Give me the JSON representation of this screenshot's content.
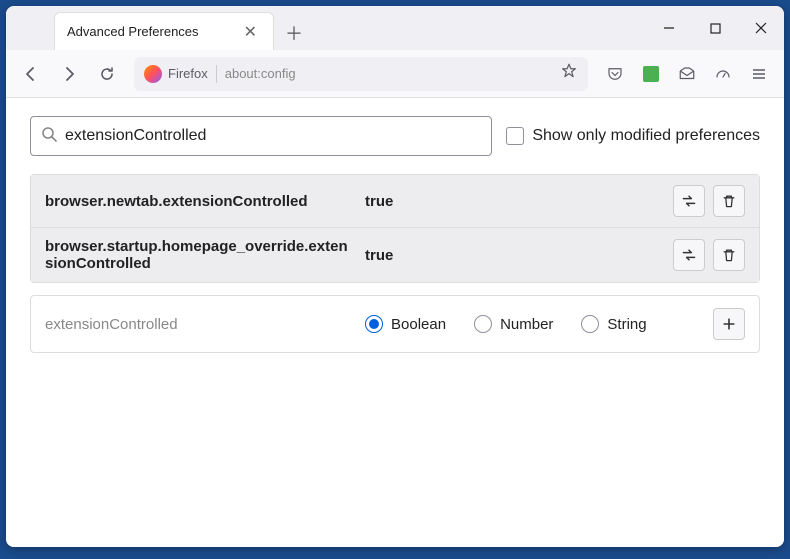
{
  "window": {
    "tab_title": "Advanced Preferences"
  },
  "urlbar": {
    "identity": "Firefox",
    "url": "about:config"
  },
  "search": {
    "value": "extensionControlled",
    "checkbox_label": "Show only modified preferences"
  },
  "prefs": [
    {
      "name": "browser.newtab.extensionControlled",
      "value": "true"
    },
    {
      "name": "browser.startup.homepage_override.extensionControlled",
      "value": "true"
    }
  ],
  "newpref": {
    "name": "extensionControlled",
    "types": [
      "Boolean",
      "Number",
      "String"
    ],
    "selected": "Boolean"
  }
}
